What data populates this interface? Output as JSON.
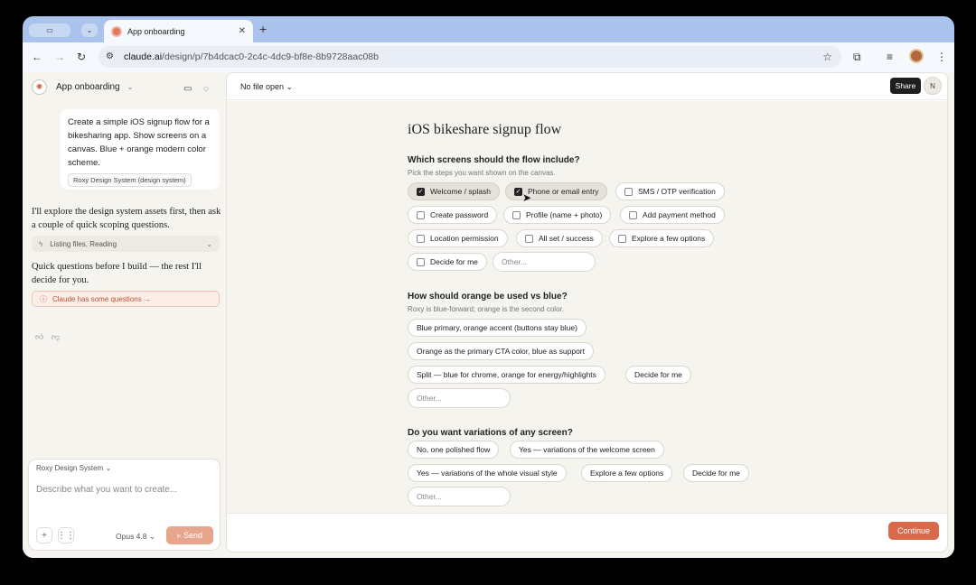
{
  "browser": {
    "tab_title": "App onboarding",
    "url_domain": "claude.ai",
    "url_path": "/design/p/7b4dcac0-2c4c-4dc9-bf8e-8b9728aac08b"
  },
  "sidebar": {
    "project_name": "App onboarding",
    "user_message": "Create a simple iOS signup flow for a bikesharing app. Show screens on a canvas. Blue + orange modern color scheme.",
    "user_chip": "Roxy Design System (design system)",
    "assistant_msg_1": "I'll explore the design system assets first, then ask a couple of quick scoping questions.",
    "tool_row": "Listing files, Reading",
    "assistant_msg_2": "Quick questions before I build — the rest I'll decide for you.",
    "questions_banner": "Claude has some questions →",
    "composer": {
      "design_system": "Roxy Design System",
      "placeholder": "Describe what you want to create...",
      "model": "Opus 4.8",
      "send": "Send"
    }
  },
  "topbar": {
    "file_label": "No file open",
    "share": "Share",
    "user_initial": "N"
  },
  "form": {
    "title": "iOS bikeshare signup flow",
    "q1": {
      "heading": "Which screens should the flow include?",
      "sub": "Pick the steps you want shown on the canvas.",
      "options": [
        {
          "label": "Welcome / splash",
          "checked": true
        },
        {
          "label": "Phone or email entry",
          "checked": true
        },
        {
          "label": "SMS / OTP verification",
          "checked": false
        },
        {
          "label": "Create password",
          "checked": false
        },
        {
          "label": "Profile (name + photo)",
          "checked": false
        },
        {
          "label": "Add payment method",
          "checked": false
        },
        {
          "label": "Location permission",
          "checked": false
        },
        {
          "label": "All set / success",
          "checked": false
        },
        {
          "label": "Explore a few options",
          "checked": false
        },
        {
          "label": "Decide for me",
          "checked": false
        }
      ],
      "other_placeholder": "Other..."
    },
    "q2": {
      "heading": "How should orange be used vs blue?",
      "sub": "Roxy is blue-forward; orange is the second color.",
      "options": [
        "Blue primary, orange accent (buttons stay blue)",
        "Orange as the primary CTA color, blue as support",
        "Split — blue for chrome, orange for energy/highlights",
        "Decide for me"
      ],
      "other_placeholder": "Other..."
    },
    "q3": {
      "heading": "Do you want variations of any screen?",
      "options": [
        "No, one polished flow",
        "Yes — variations of the welcome screen",
        "Yes — variations of the whole visual style",
        "Explore a few options",
        "Decide for me"
      ],
      "other_placeholder": "Other..."
    },
    "continue": "Continue"
  },
  "colors": {
    "accent": "#d9694a",
    "send_disabled": "#e8a58e",
    "window_frame": "#a9c3ec"
  }
}
